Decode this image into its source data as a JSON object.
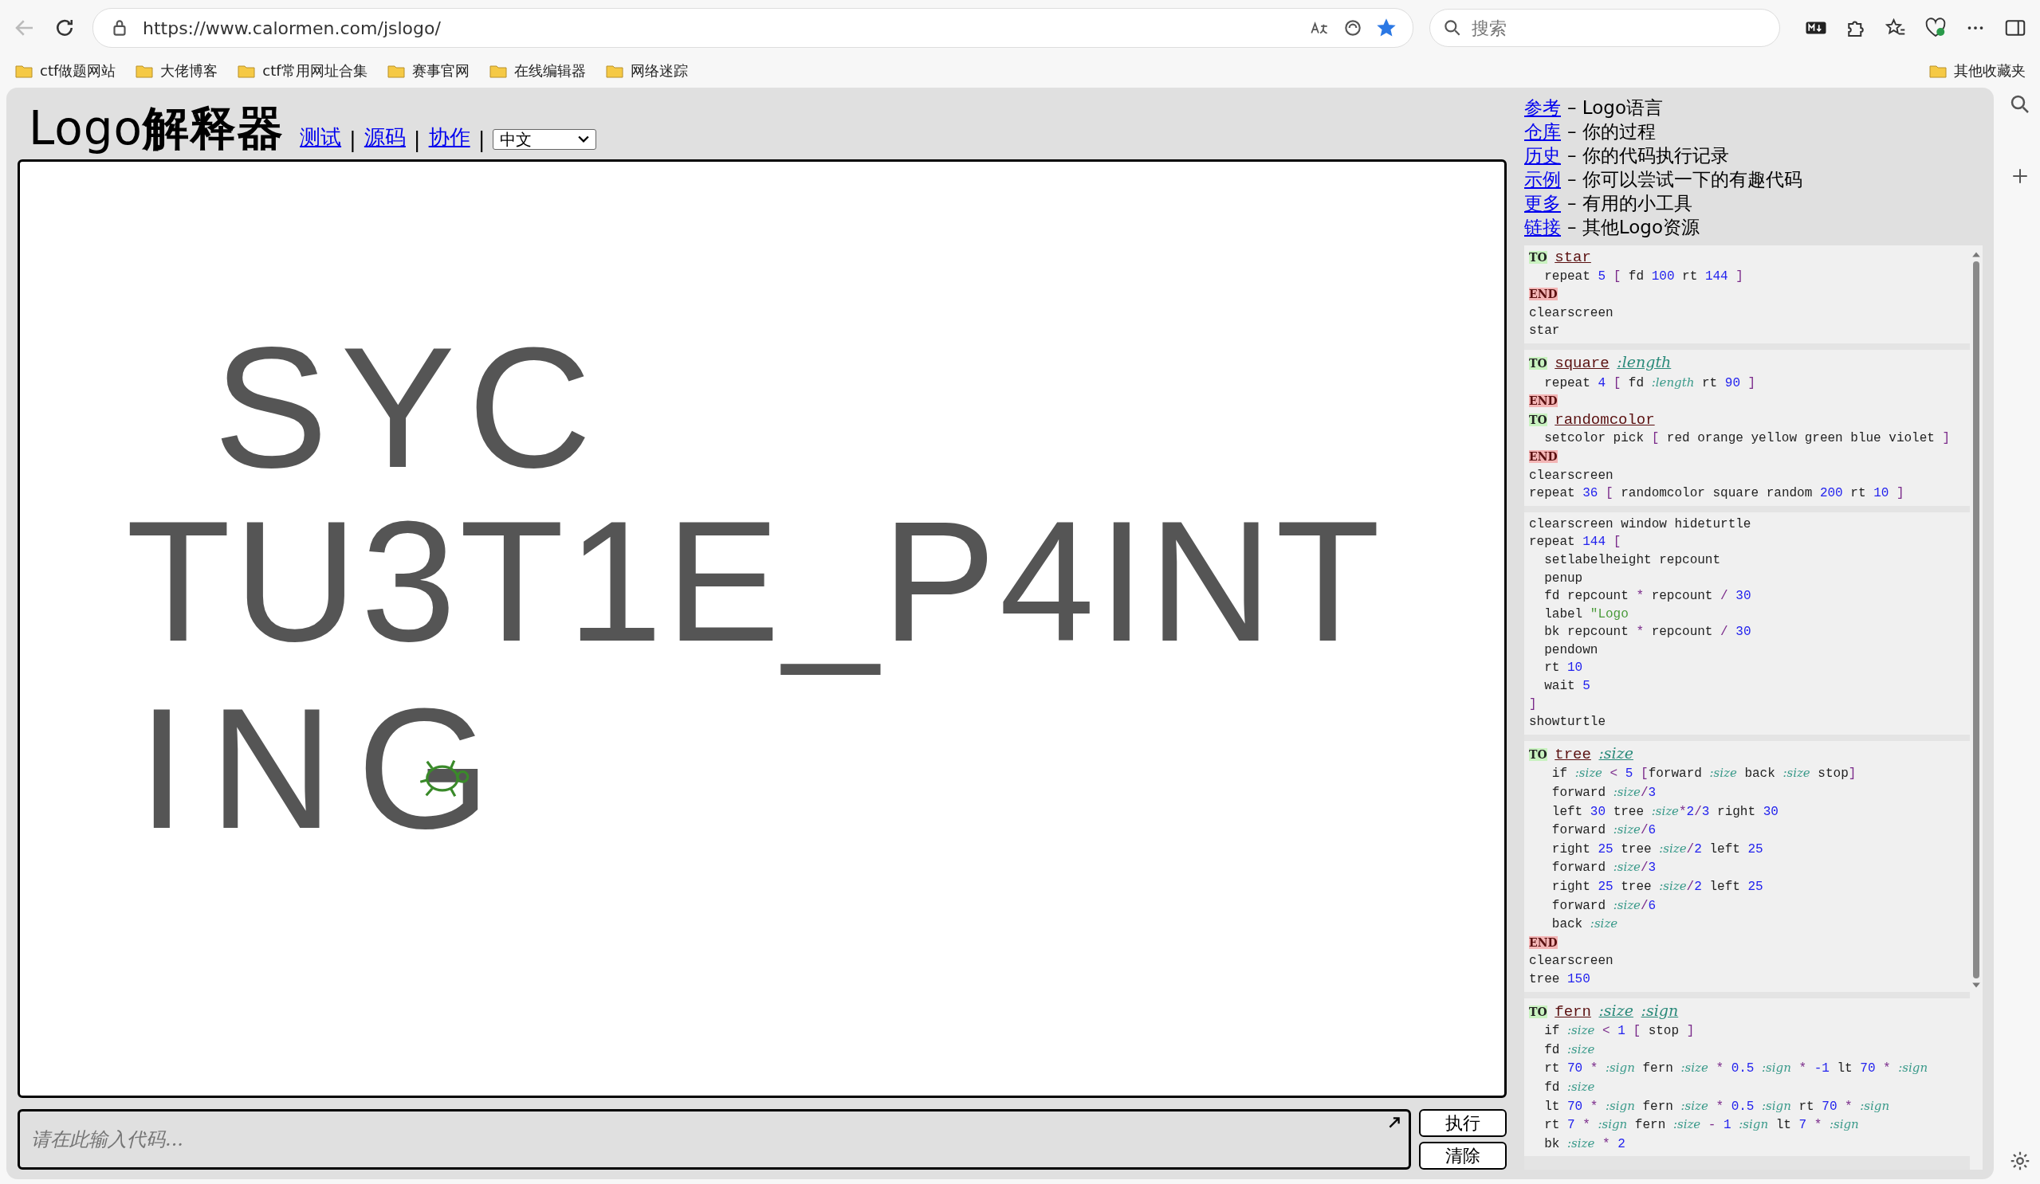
{
  "browser": {
    "url": "https://www.calormen.com/jslogo/",
    "favorited": true,
    "search_placeholder": "搜索",
    "bookmarks": [
      "ctf做题网站",
      "大佬博客",
      "ctf常用网址合集",
      "赛事官网",
      "在线编辑器",
      "网络迷踪"
    ],
    "other_bookmarks": "其他收藏夹"
  },
  "header": {
    "title": "Logo**解释器**",
    "links": [
      "测试",
      "源码",
      "协作"
    ],
    "separator": "|",
    "language": "中文"
  },
  "canvas": {
    "drawn_lines": [
      "SYC",
      "TU3T1E_P4INT",
      "ING"
    ],
    "turtle_visible": true
  },
  "input": {
    "placeholder": "请在此输入代码..."
  },
  "buttons": [
    "执行",
    "清除"
  ],
  "reference": [
    {
      "link": "参考",
      "description": "– Logo语言"
    },
    {
      "link": "仓库",
      "description": "– 你的过程"
    },
    {
      "link": "历史",
      "description": "– 你的代码执行记录"
    },
    {
      "link": "示例",
      "description": "– 你可以尝试一下的有趣代码"
    },
    {
      "link": "更多",
      "description": "– 有用的小工具"
    },
    {
      "link": "链接",
      "description": "– 其他Logo资源"
    }
  ],
  "examples": [
    [
      [
        {
          "kind": "to",
          "text": "TO"
        },
        {
          "kind": "proc",
          "text": " star"
        }
      ],
      [
        {
          "kind": "text",
          "text": "  repeat "
        },
        {
          "kind": "num",
          "text": "5"
        },
        {
          "kind": "punct",
          "text": " ["
        },
        {
          "kind": "text",
          "text": " fd "
        },
        {
          "kind": "num",
          "text": "100"
        },
        {
          "kind": "text",
          "text": " rt "
        },
        {
          "kind": "num",
          "text": "144"
        },
        {
          "kind": "punct",
          "text": " ]"
        }
      ],
      [
        {
          "kind": "end",
          "text": "END"
        }
      ],
      [
        {
          "kind": "text",
          "text": "clearscreen"
        }
      ],
      [
        {
          "kind": "text",
          "text": "star"
        }
      ]
    ],
    [
      [
        {
          "kind": "to",
          "text": "TO"
        },
        {
          "kind": "proc",
          "text": " square"
        },
        {
          "kind": "arg",
          "text": " :length"
        }
      ],
      [
        {
          "kind": "text",
          "text": "  repeat "
        },
        {
          "kind": "num",
          "text": "4"
        },
        {
          "kind": "punct",
          "text": " ["
        },
        {
          "kind": "text",
          "text": " fd "
        },
        {
          "kind": "param",
          "text": ":length"
        },
        {
          "kind": "text",
          "text": " rt "
        },
        {
          "kind": "num",
          "text": "90"
        },
        {
          "kind": "punct",
          "text": " ]"
        }
      ],
      [
        {
          "kind": "end",
          "text": "END"
        }
      ],
      [
        {
          "kind": "to",
          "text": "TO"
        },
        {
          "kind": "proc",
          "text": " randomcolor"
        }
      ],
      [
        {
          "kind": "text",
          "text": "  setcolor pick "
        },
        {
          "kind": "punct",
          "text": "["
        },
        {
          "kind": "text",
          "text": " red orange yellow green blue violet "
        },
        {
          "kind": "punct",
          "text": "]"
        }
      ],
      [
        {
          "kind": "end",
          "text": "END"
        }
      ],
      [
        {
          "kind": "text",
          "text": "clearscreen"
        }
      ],
      [
        {
          "kind": "text",
          "text": "repeat "
        },
        {
          "kind": "num",
          "text": "36"
        },
        {
          "kind": "punct",
          "text": " ["
        },
        {
          "kind": "text",
          "text": " randomcolor square random "
        },
        {
          "kind": "num",
          "text": "200"
        },
        {
          "kind": "text",
          "text": " rt "
        },
        {
          "kind": "num",
          "text": "10"
        },
        {
          "kind": "punct",
          "text": " ]"
        }
      ]
    ],
    [
      [
        {
          "kind": "text",
          "text": "clearscreen window hideturtle"
        }
      ],
      [
        {
          "kind": "text",
          "text": "repeat "
        },
        {
          "kind": "num",
          "text": "144"
        },
        {
          "kind": "punct",
          "text": " ["
        }
      ],
      [
        {
          "kind": "text",
          "text": "  setlabelheight repcount"
        }
      ],
      [
        {
          "kind": "text",
          "text": "  penup"
        }
      ],
      [
        {
          "kind": "text",
          "text": "  fd repcount "
        },
        {
          "kind": "punct",
          "text": "*"
        },
        {
          "kind": "text",
          "text": " repcount "
        },
        {
          "kind": "punct",
          "text": "/"
        },
        {
          "kind": "num",
          "text": " 30"
        }
      ],
      [
        {
          "kind": "text",
          "text": "  label "
        },
        {
          "kind": "string",
          "text": "\"Logo"
        }
      ],
      [
        {
          "kind": "text",
          "text": "  bk repcount "
        },
        {
          "kind": "punct",
          "text": "*"
        },
        {
          "kind": "text",
          "text": " repcount "
        },
        {
          "kind": "punct",
          "text": "/"
        },
        {
          "kind": "num",
          "text": " 30"
        }
      ],
      [
        {
          "kind": "text",
          "text": "  pendown"
        }
      ],
      [
        {
          "kind": "text",
          "text": "  rt "
        },
        {
          "kind": "num",
          "text": "10"
        }
      ],
      [
        {
          "kind": "text",
          "text": "  wait "
        },
        {
          "kind": "num",
          "text": "5"
        }
      ],
      [
        {
          "kind": "punct",
          "text": "]"
        }
      ],
      [
        {
          "kind": "text",
          "text": "showturtle"
        }
      ]
    ],
    [
      [
        {
          "kind": "to",
          "text": "TO"
        },
        {
          "kind": "proc",
          "text": " tree"
        },
        {
          "kind": "arg",
          "text": " :size"
        }
      ],
      [
        {
          "kind": "text",
          "text": "   if "
        },
        {
          "kind": "param",
          "text": ":size"
        },
        {
          "kind": "punct",
          "text": " <"
        },
        {
          "kind": "num",
          "text": " 5"
        },
        {
          "kind": "punct",
          "text": " ["
        },
        {
          "kind": "text",
          "text": "forward "
        },
        {
          "kind": "param",
          "text": ":size"
        },
        {
          "kind": "text",
          "text": " back "
        },
        {
          "kind": "param",
          "text": ":size"
        },
        {
          "kind": "text",
          "text": " stop"
        },
        {
          "kind": "punct",
          "text": "]"
        }
      ],
      [
        {
          "kind": "text",
          "text": "   forward "
        },
        {
          "kind": "param",
          "text": ":size"
        },
        {
          "kind": "punct",
          "text": "/"
        },
        {
          "kind": "num",
          "text": "3"
        }
      ],
      [
        {
          "kind": "text",
          "text": "   left "
        },
        {
          "kind": "num",
          "text": "30"
        },
        {
          "kind": "text",
          "text": " tree "
        },
        {
          "kind": "param",
          "text": ":size"
        },
        {
          "kind": "punct",
          "text": "*"
        },
        {
          "kind": "num",
          "text": "2"
        },
        {
          "kind": "punct",
          "text": "/"
        },
        {
          "kind": "num",
          "text": "3"
        },
        {
          "kind": "text",
          "text": " right "
        },
        {
          "kind": "num",
          "text": "30"
        }
      ],
      [
        {
          "kind": "text",
          "text": "   forward "
        },
        {
          "kind": "param",
          "text": ":size"
        },
        {
          "kind": "punct",
          "text": "/"
        },
        {
          "kind": "num",
          "text": "6"
        }
      ],
      [
        {
          "kind": "text",
          "text": "   right "
        },
        {
          "kind": "num",
          "text": "25"
        },
        {
          "kind": "text",
          "text": " tree "
        },
        {
          "kind": "param",
          "text": ":size"
        },
        {
          "kind": "punct",
          "text": "/"
        },
        {
          "kind": "num",
          "text": "2"
        },
        {
          "kind": "text",
          "text": " left "
        },
        {
          "kind": "num",
          "text": "25"
        }
      ],
      [
        {
          "kind": "text",
          "text": "   forward "
        },
        {
          "kind": "param",
          "text": ":size"
        },
        {
          "kind": "punct",
          "text": "/"
        },
        {
          "kind": "num",
          "text": "3"
        }
      ],
      [
        {
          "kind": "text",
          "text": "   right "
        },
        {
          "kind": "num",
          "text": "25"
        },
        {
          "kind": "text",
          "text": " tree "
        },
        {
          "kind": "param",
          "text": ":size"
        },
        {
          "kind": "punct",
          "text": "/"
        },
        {
          "kind": "num",
          "text": "2"
        },
        {
          "kind": "text",
          "text": " left "
        },
        {
          "kind": "num",
          "text": "25"
        }
      ],
      [
        {
          "kind": "text",
          "text": "   forward "
        },
        {
          "kind": "param",
          "text": ":size"
        },
        {
          "kind": "punct",
          "text": "/"
        },
        {
          "kind": "num",
          "text": "6"
        }
      ],
      [
        {
          "kind": "text",
          "text": "   back "
        },
        {
          "kind": "param",
          "text": ":size"
        }
      ],
      [
        {
          "kind": "end",
          "text": "END"
        }
      ],
      [
        {
          "kind": "text",
          "text": "clearscreen"
        }
      ],
      [
        {
          "kind": "text",
          "text": "tree "
        },
        {
          "kind": "num",
          "text": "150"
        }
      ]
    ],
    [
      [
        {
          "kind": "to",
          "text": "TO"
        },
        {
          "kind": "proc",
          "text": " fern"
        },
        {
          "kind": "arg",
          "text": " :size"
        },
        {
          "kind": "arg",
          "text": " :sign"
        }
      ],
      [
        {
          "kind": "text",
          "text": "  if "
        },
        {
          "kind": "param",
          "text": ":size"
        },
        {
          "kind": "punct",
          "text": " <"
        },
        {
          "kind": "num",
          "text": " 1"
        },
        {
          "kind": "punct",
          "text": " ["
        },
        {
          "kind": "text",
          "text": " stop "
        },
        {
          "kind": "punct",
          "text": "]"
        }
      ],
      [
        {
          "kind": "text",
          "text": "  fd "
        },
        {
          "kind": "param",
          "text": ":size"
        }
      ],
      [
        {
          "kind": "text",
          "text": "  rt "
        },
        {
          "kind": "num",
          "text": "70"
        },
        {
          "kind": "punct",
          "text": " * "
        },
        {
          "kind": "param",
          "text": ":sign"
        },
        {
          "kind": "text",
          "text": " fern "
        },
        {
          "kind": "param",
          "text": ":size"
        },
        {
          "kind": "punct",
          "text": " * "
        },
        {
          "kind": "num",
          "text": "0.5"
        },
        {
          "kind": "param",
          "text": " :sign"
        },
        {
          "kind": "punct",
          "text": " * "
        },
        {
          "kind": "num",
          "text": "-1"
        },
        {
          "kind": "text",
          "text": " lt "
        },
        {
          "kind": "num",
          "text": "70"
        },
        {
          "kind": "punct",
          "text": " * "
        },
        {
          "kind": "param",
          "text": ":sign"
        }
      ],
      [
        {
          "kind": "text",
          "text": "  fd "
        },
        {
          "kind": "param",
          "text": ":size"
        }
      ],
      [
        {
          "kind": "text",
          "text": "  lt "
        },
        {
          "kind": "num",
          "text": "70"
        },
        {
          "kind": "punct",
          "text": " * "
        },
        {
          "kind": "param",
          "text": ":sign"
        },
        {
          "kind": "text",
          "text": " fern "
        },
        {
          "kind": "param",
          "text": ":size"
        },
        {
          "kind": "punct",
          "text": " * "
        },
        {
          "kind": "num",
          "text": "0.5"
        },
        {
          "kind": "param",
          "text": " :sign"
        },
        {
          "kind": "text",
          "text": " rt "
        },
        {
          "kind": "num",
          "text": "70"
        },
        {
          "kind": "punct",
          "text": " * "
        },
        {
          "kind": "param",
          "text": ":sign"
        }
      ],
      [
        {
          "kind": "text",
          "text": "  rt "
        },
        {
          "kind": "num",
          "text": "7"
        },
        {
          "kind": "punct",
          "text": " * "
        },
        {
          "kind": "param",
          "text": ":sign"
        },
        {
          "kind": "text",
          "text": " fern "
        },
        {
          "kind": "param",
          "text": ":size"
        },
        {
          "kind": "punct",
          "text": " - "
        },
        {
          "kind": "num",
          "text": "1"
        },
        {
          "kind": "param",
          "text": " :sign"
        },
        {
          "kind": "text",
          "text": " lt "
        },
        {
          "kind": "num",
          "text": "7"
        },
        {
          "kind": "punct",
          "text": " * "
        },
        {
          "kind": "param",
          "text": ":sign"
        }
      ],
      [
        {
          "kind": "text",
          "text": "  bk "
        },
        {
          "kind": "param",
          "text": ":size"
        },
        {
          "kind": "punct",
          "text": " * "
        },
        {
          "kind": "num",
          "text": "2"
        }
      ]
    ]
  ]
}
